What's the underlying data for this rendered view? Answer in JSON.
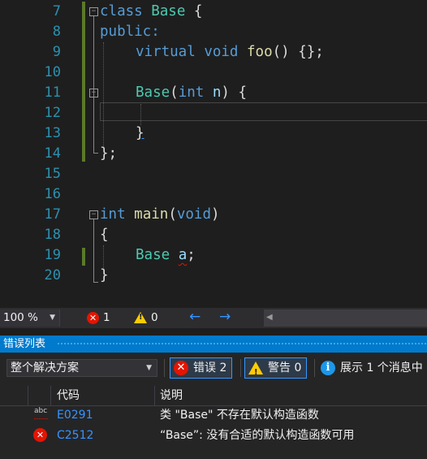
{
  "editor": {
    "lines": [
      {
        "num": "7"
      },
      {
        "num": "8"
      },
      {
        "num": "9"
      },
      {
        "num": "10"
      },
      {
        "num": "11"
      },
      {
        "num": "12"
      },
      {
        "num": "13"
      },
      {
        "num": "14"
      },
      {
        "num": "15"
      },
      {
        "num": "16"
      },
      {
        "num": "17"
      },
      {
        "num": "18"
      },
      {
        "num": "19"
      },
      {
        "num": "20"
      }
    ],
    "tokens": {
      "l7_kw": "class",
      "l7_name": "Base",
      "l7_rest": " {",
      "l8": "public:",
      "l9_kw1": "virtual",
      "l9_kw2": "void",
      "l9_fn": "foo",
      "l9_rest": "() {};",
      "l11_ty": "Base",
      "l11_p1": "(",
      "l11_kw": "int",
      "l11_pm": "n",
      "l11_rest": ") {",
      "l13": "}",
      "l14": "};",
      "l17_kw1": "int",
      "l17_fn": "main",
      "l17_p1": "(",
      "l17_kw2": "void",
      "l17_p2": ")",
      "l18": "{",
      "l19_ty": "Base",
      "l19_var": "a",
      "l19_rest": ";",
      "l20": "}"
    }
  },
  "statusbar": {
    "zoom": "100 %",
    "error_count": "1",
    "warning_count": "0",
    "nav_back": "←",
    "nav_forward": "→"
  },
  "error_list": {
    "title": "错误列表",
    "scope": "整个解决方案",
    "errors_label": "错误 2",
    "warnings_label": "警告 0",
    "messages_label": "展示 1 个消息中",
    "columns": {
      "code": "代码",
      "description": "说明"
    },
    "rows": [
      {
        "code": "E0291",
        "description": "类 \"Base\" 不存在默认构造函数",
        "icon": "spelling-error-icon"
      },
      {
        "code": "C2512",
        "description": "“Base”: 没有合适的默认构造函数可用",
        "icon": "error-icon"
      }
    ]
  },
  "colors": {
    "accent": "#007acc",
    "error": "#e51400",
    "warning": "#ffcc00",
    "keyword": "#569cd6",
    "type": "#4ec9b0",
    "function": "#dcdcaa"
  }
}
